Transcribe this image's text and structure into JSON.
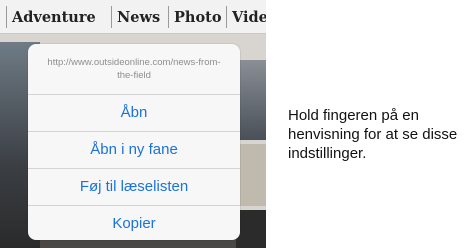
{
  "tabs": [
    "Adventure",
    "News",
    "Photo",
    "Vide"
  ],
  "popover": {
    "url": "http://www.outsideonline.com/news-from-the-field",
    "actions": [
      "Åbn",
      "Åbn i ny fane",
      "Føj til læselisten",
      "Kopier"
    ]
  },
  "caption": "Hold fingeren på en henvisning for at se disse indstillinger.",
  "colors": {
    "link_blue": "#1a73d9",
    "sheet_bg": "#f7f7f7",
    "caption_text": "#111111"
  }
}
